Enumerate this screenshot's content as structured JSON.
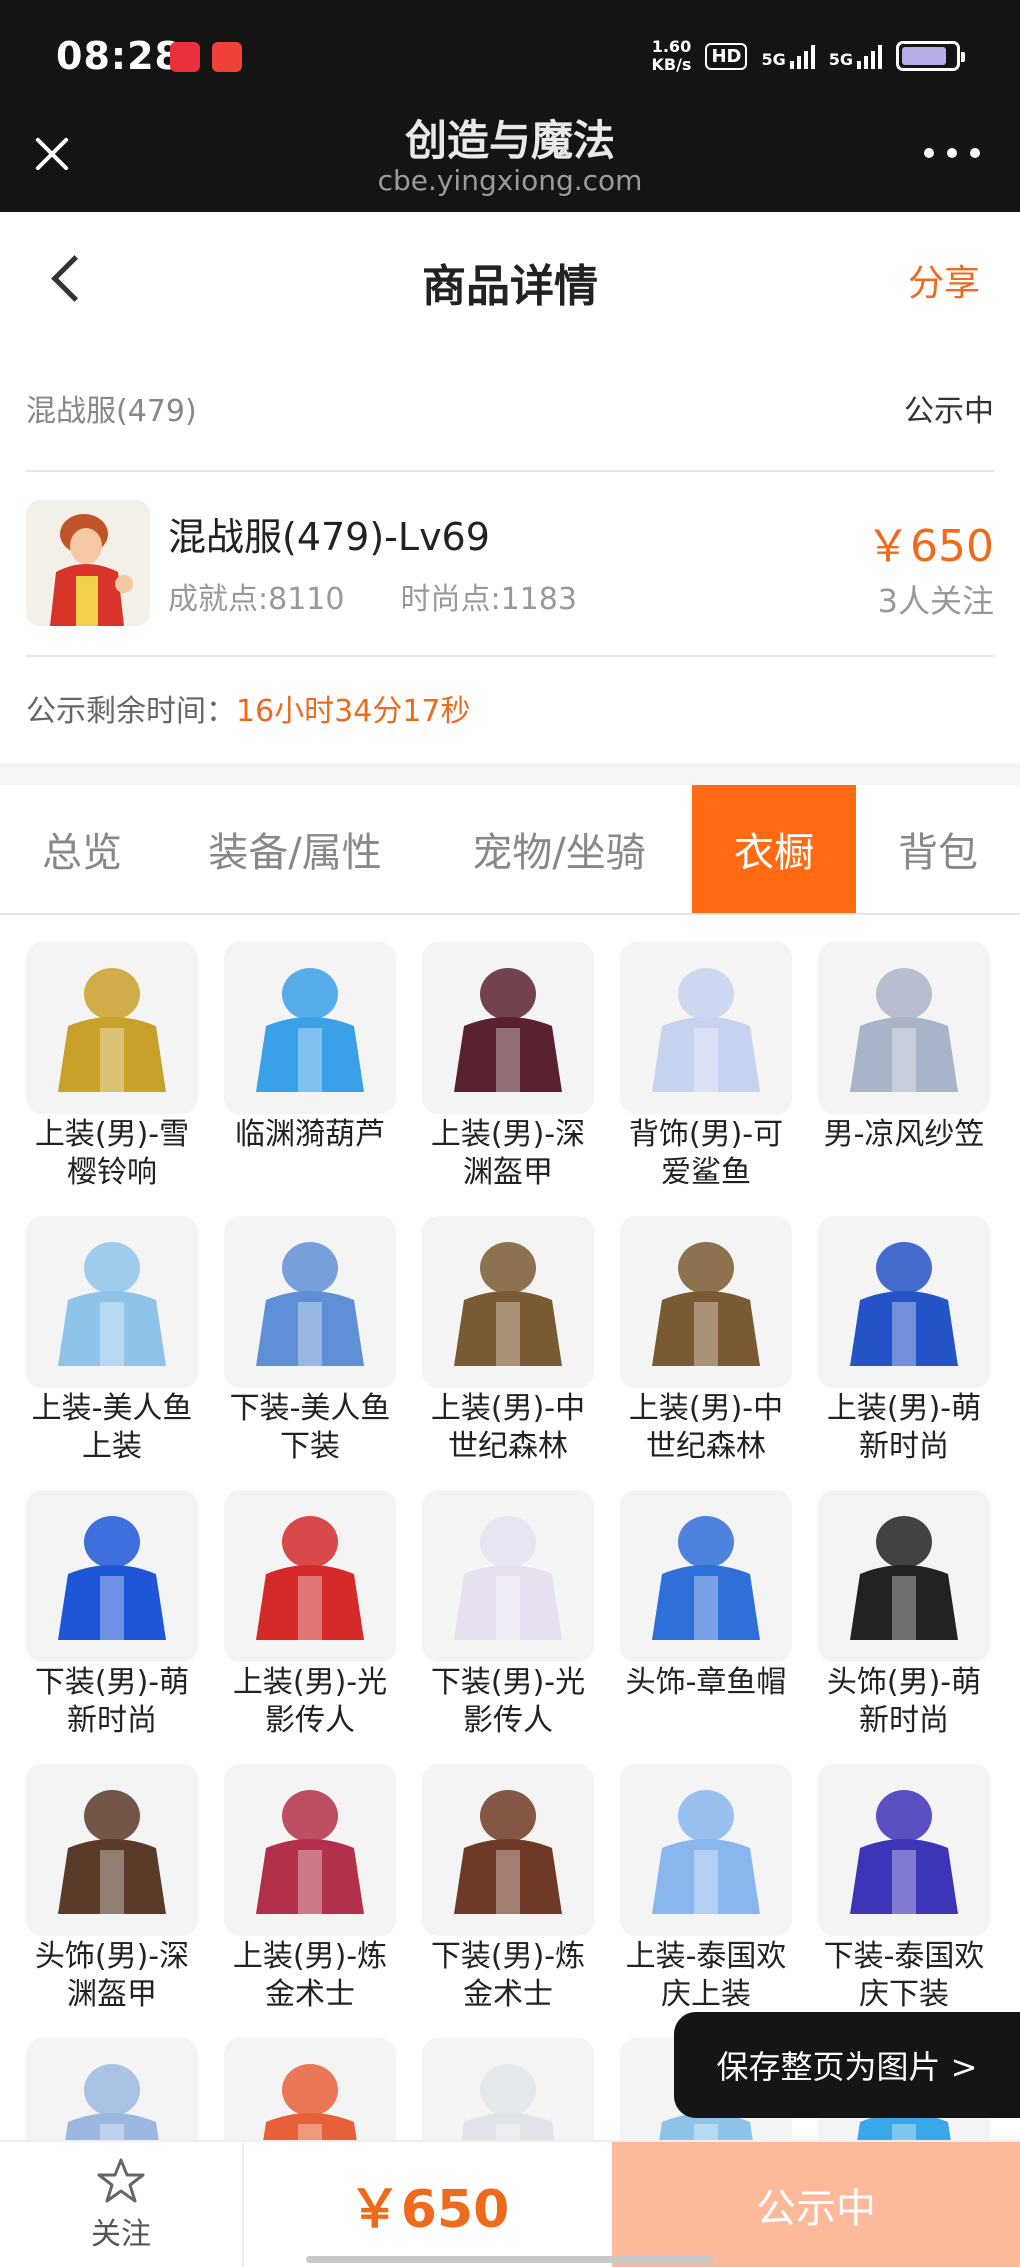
{
  "status_bar": {
    "time": "08:28",
    "net_speed_value": "1.60",
    "net_speed_unit": "KB/s",
    "hd_label": "HD",
    "signal_1": "5G",
    "signal_2": "5G",
    "battery_level": 0.85,
    "app_icons": [
      "xiaohongshu-icon",
      "video-app-icon"
    ]
  },
  "browser": {
    "title": "创造与魔法",
    "url": "cbe.yingxiong.com"
  },
  "header": {
    "title": "商品详情",
    "share_label": "分享"
  },
  "listing": {
    "server": "混战服(479)",
    "status": "公示中",
    "item_name": "混战服(479)-Lv69",
    "achievement_label": "成就点:8110",
    "fashion_label": "时尚点:1183",
    "price": "￥650",
    "watchers": "3人关注",
    "remaining_label": "公示剩余时间：",
    "remaining_value": "16小时34分17秒"
  },
  "tabs": [
    {
      "label": "总览"
    },
    {
      "label": "装备/属性"
    },
    {
      "label": "宠物/坐骑"
    },
    {
      "label": "衣橱",
      "active": true
    },
    {
      "label": "背包"
    }
  ],
  "wardrobe": [
    {
      "label": "上装(男)-雪樱铃响",
      "color": "#c9a02a"
    },
    {
      "label": "临渊漪葫芦",
      "color": "#3aa0e8"
    },
    {
      "label": "上装(男)-深渊盔甲",
      "color": "#5a2230"
    },
    {
      "label": "背饰(男)-可爱鲨鱼",
      "color": "#c7d2ee"
    },
    {
      "label": "男-凉风纱笠",
      "color": "#aab4c8"
    },
    {
      "label": "上装-美人鱼上装",
      "color": "#8fc4ea"
    },
    {
      "label": "下装-美人鱼下装",
      "color": "#5f8fd6"
    },
    {
      "label": "上装(男)-中世纪森林",
      "color": "#7a5a32"
    },
    {
      "label": "上装(男)-中世纪森林",
      "color": "#7a5a32"
    },
    {
      "label": "上装(男)-萌新时尚",
      "color": "#2553c8"
    },
    {
      "label": "下装(男)-萌新时尚",
      "color": "#1f56d8"
    },
    {
      "label": "上装(男)-光影传人",
      "color": "#d42a2a"
    },
    {
      "label": "下装(男)-光影传人",
      "color": "#e6e0f0"
    },
    {
      "label": "头饰-章鱼帽",
      "color": "#2f6fd8"
    },
    {
      "label": "头饰(男)-萌新时尚",
      "color": "#222222"
    },
    {
      "label": "头饰(男)-深渊盔甲",
      "color": "#5a3a28"
    },
    {
      "label": "上装(男)-炼金术士",
      "color": "#b3304a"
    },
    {
      "label": "下装(男)-炼金术士",
      "color": "#6e3a26"
    },
    {
      "label": "上装-泰国欢庆上装",
      "color": "#8ab6ee"
    },
    {
      "label": "下装-泰国欢庆下装",
      "color": "#3d34b8"
    },
    {
      "label": "",
      "color": "#9cb8e0"
    },
    {
      "label": "",
      "color": "#e8603a"
    },
    {
      "label": "",
      "color": "#e0e4ea"
    },
    {
      "label": "",
      "color": "#8fc4ea"
    },
    {
      "label": "",
      "color": "#3aa8e8"
    }
  ],
  "save_button": "保存整页为图片 >",
  "bottom": {
    "follow_label": "关注",
    "price": "￥650",
    "status": "公示中"
  },
  "colors": {
    "accent": "#ee6a1c",
    "tab_active": "#ff6a13",
    "bottom_status_bg": "#fdb99a"
  }
}
